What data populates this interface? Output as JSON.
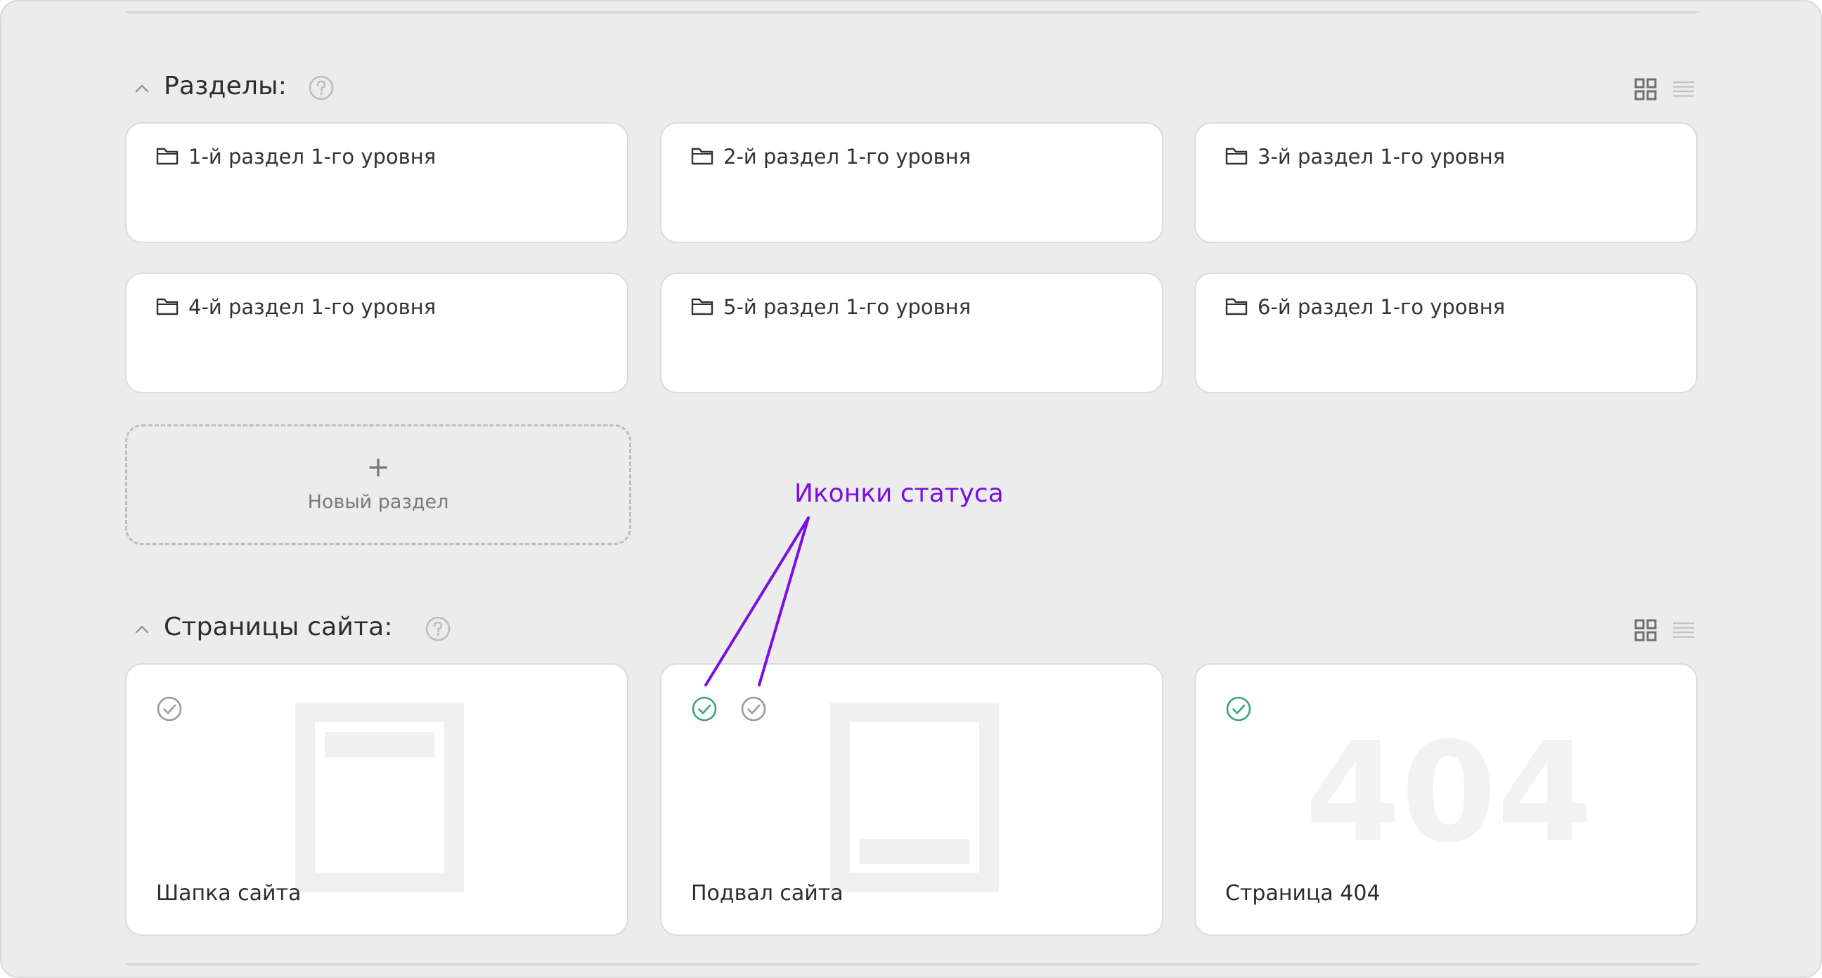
{
  "sections_block": {
    "title": "Разделы:",
    "help_icon": "question-circle-icon",
    "collapse_icon": "chevron-up-icon",
    "view_icons": [
      "grid-view-icon",
      "list-view-icon"
    ],
    "items": [
      {
        "label": "1-й раздел 1-го уровня",
        "icon": "folder-icon"
      },
      {
        "label": "2-й раздел 1-го уровня",
        "icon": "folder-icon"
      },
      {
        "label": "3-й раздел 1-го уровня",
        "icon": "folder-icon"
      },
      {
        "label": "4-й раздел 1-го уровня",
        "icon": "folder-icon"
      },
      {
        "label": "5-й раздел 1-го уровня",
        "icon": "folder-icon"
      },
      {
        "label": "6-й раздел 1-го уровня",
        "icon": "folder-icon"
      }
    ],
    "new_item": {
      "icon": "plus-icon",
      "label": "Новый раздел"
    }
  },
  "pages_block": {
    "title": "Страницы сайта:",
    "help_icon": "question-circle-icon",
    "collapse_icon": "chevron-up-icon",
    "view_icons": [
      "grid-view-icon",
      "list-view-icon"
    ],
    "items": [
      {
        "label": "Шапка сайта",
        "preview": "header-template-icon",
        "statuses": [
          "inactive"
        ]
      },
      {
        "label": "Подвал сайта",
        "preview": "footer-template-icon",
        "statuses": [
          "active",
          "inactive"
        ]
      },
      {
        "label": "Страница 404",
        "preview": "404-watermark",
        "preview_text": "404",
        "statuses": [
          "active"
        ]
      }
    ]
  },
  "annotation": {
    "label": "Иконки статуса",
    "color": "#7a10e0"
  },
  "colors": {
    "status_active": "#3aa37f",
    "status_inactive": "#9a9a9a",
    "background": "#ececec",
    "card": "#ffffff"
  }
}
